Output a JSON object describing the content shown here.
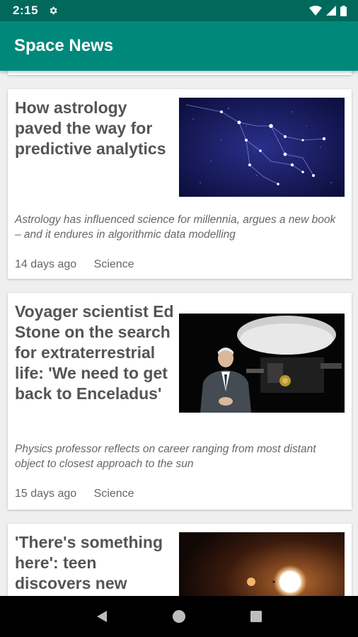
{
  "status_bar": {
    "time": "2:15"
  },
  "app_bar": {
    "title": "Space News"
  },
  "articles": [
    {
      "title": "How astrology paved the way for predictive analytics",
      "summary": "Astrology has influenced science for millennia, argues a new book – and it endures in algorithmic data modelling",
      "age": "14 days ago",
      "category": "Science",
      "image": "constellation-image"
    },
    {
      "title": "Voyager scientist Ed Stone on the search for extraterrestrial life: 'We need to get back to Enceladus'",
      "summary": "Physics professor reflects on career ranging from most distant object to closest approach to the sun",
      "age": "15 days ago",
      "category": "Science",
      "image": "voyager-scientist-image"
    },
    {
      "title": "'There's something here': teen discovers new",
      "image": "exoplanet-star-image"
    }
  ],
  "colors": {
    "status_bar": "#00695c",
    "app_bar": "#00897b"
  }
}
